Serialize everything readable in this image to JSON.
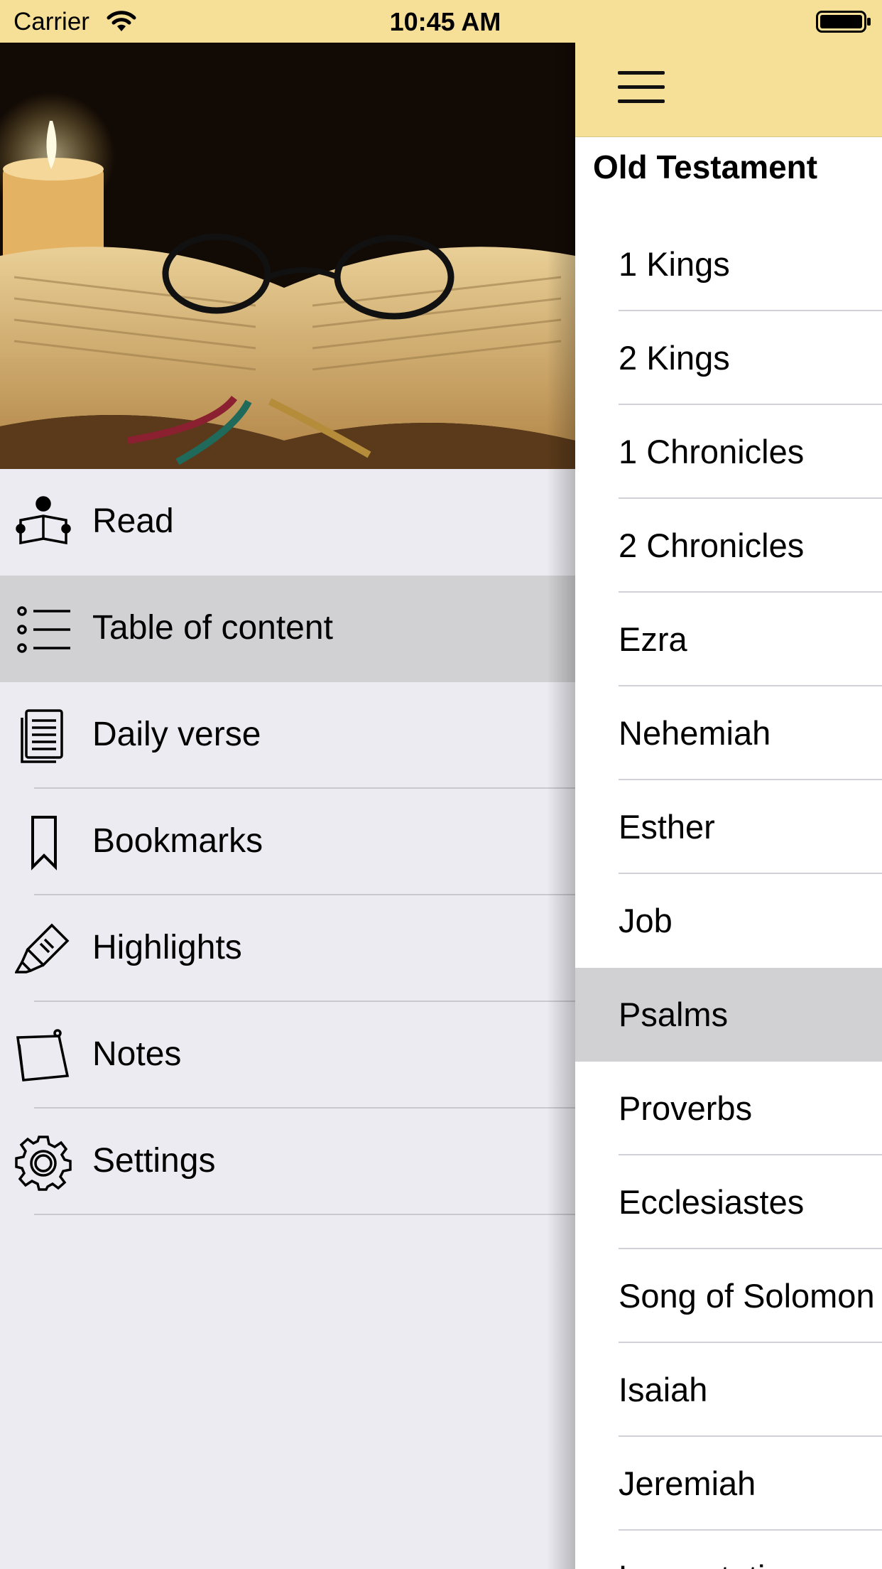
{
  "status_bar": {
    "carrier": "Carrier",
    "time": "10:45 AM"
  },
  "menu": {
    "items": [
      {
        "label": "Read",
        "icon": "reader-icon"
      },
      {
        "label": "Table of content",
        "icon": "list-icon"
      },
      {
        "label": "Daily verse",
        "icon": "document-icon"
      },
      {
        "label": "Bookmarks",
        "icon": "bookmark-icon"
      },
      {
        "label": "Highlights",
        "icon": "highlighter-icon"
      },
      {
        "label": "Notes",
        "icon": "note-icon"
      },
      {
        "label": "Settings",
        "icon": "gear-icon"
      }
    ],
    "selected": "Table of content"
  },
  "toc": {
    "section": "Old Testament",
    "books": [
      "1 Kings",
      "2 Kings",
      "1 Chronicles",
      "2 Chronicles",
      "Ezra",
      "Nehemiah",
      "Esther",
      "Job",
      "Psalms",
      "Proverbs",
      "Ecclesiastes",
      "Song of Solomon",
      "Isaiah",
      "Jeremiah",
      "Lamentations"
    ],
    "selected": "Psalms"
  },
  "colors": {
    "accent_bar": "#f6df97",
    "selected_row": "#d1d1d3",
    "background": "#ecebf1"
  }
}
